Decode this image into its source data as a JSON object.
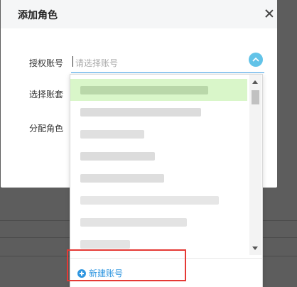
{
  "dialog": {
    "title": "添加角色",
    "labels": {
      "authorized_account": "授权账号",
      "select_package": "选择账套",
      "assign_role": "分配角色"
    },
    "auth_input": {
      "placeholder": "请选择账号",
      "value": ""
    }
  },
  "dropdown": {
    "options_count": 8,
    "selected_index": 0,
    "footer": {
      "new_account_label": "新建账号"
    }
  },
  "colors": {
    "accent": "#3ca0e8",
    "selected_bg": "#d9f6c9",
    "link": "#2f96e0",
    "highlight": "#e53935"
  }
}
